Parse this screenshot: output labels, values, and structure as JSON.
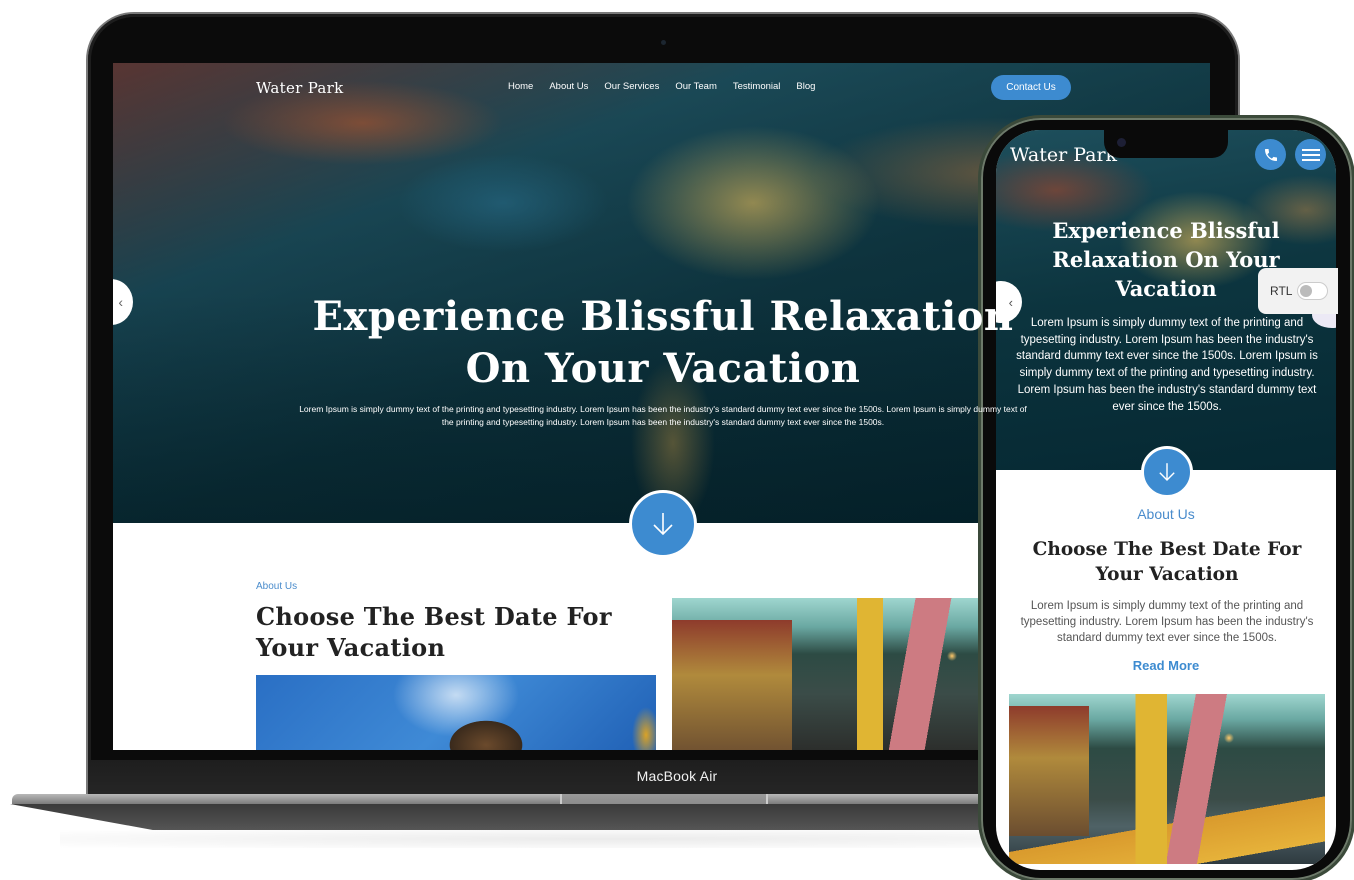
{
  "laptop": {
    "device_label": "MacBook Air",
    "site": {
      "logo": "Water Park",
      "nav": [
        "Home",
        "About Us",
        "Our Services",
        "Our Team",
        "Testimonial",
        "Blog"
      ],
      "contact_button": "Contact Us",
      "hero": {
        "title": "Experience Blissful Relaxation On Your Vacation",
        "subtitle": "Lorem Ipsum is simply dummy text of the printing and typesetting industry. Lorem Ipsum has been the industry's standard dummy text ever since the 1500s. Lorem Ipsum is simply dummy text of the printing and typesetting industry. Lorem Ipsum has been the industry's standard dummy text ever since the 1500s."
      },
      "about": {
        "label": "About Us",
        "title": "Choose The Best Date For Your Vacation"
      }
    }
  },
  "phone": {
    "site": {
      "logo": "Water Park",
      "hero": {
        "title": "Experience Blissful Relaxation On Your Vacation",
        "subtitle": "Lorem Ipsum is simply dummy text of the printing and typesetting industry. Lorem Ipsum has been the industry's standard dummy text ever since the 1500s. Lorem Ipsum is simply dummy text of the printing and typesetting industry. Lorem Ipsum has been the industry's standard dummy text ever since the 1500s."
      },
      "about": {
        "label": "About Us",
        "title": "Choose The Best Date For Your Vacation",
        "text": "Lorem Ipsum is simply dummy text of the printing and typesetting industry. Lorem Ipsum has been the industry's standard dummy text ever since the 1500s.",
        "read_more": "Read More"
      }
    }
  },
  "rtl_toggle": {
    "label": "RTL",
    "enabled": false
  },
  "icons": {
    "prev": "‹",
    "call": "phone-icon",
    "menu": "hamburger-menu-icon",
    "scroll_down": "arrow-down-icon"
  },
  "colors": {
    "accent": "#3d8bd0",
    "label_blue": "#4a8ccc",
    "heading": "#222222"
  }
}
